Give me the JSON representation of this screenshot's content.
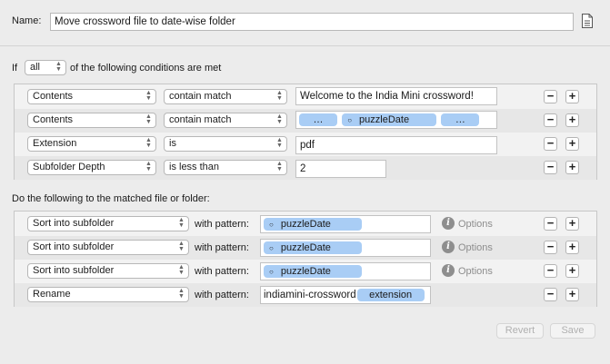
{
  "name_label": "Name:",
  "name_value": "Move crossword file to date-wise folder",
  "if_label": "If",
  "match_mode": "all",
  "conditions_suffix": "of the following conditions are met",
  "conditions": [
    {
      "attribute": "Contents",
      "operator": "contain match",
      "value_text": "Welcome to the India Mini crossword!"
    },
    {
      "attribute": "Contents",
      "operator": "contain match",
      "tokens": [
        "…",
        "puzzleDate",
        "…"
      ]
    },
    {
      "attribute": "Extension",
      "operator": "is",
      "value_text": "pdf"
    },
    {
      "attribute": "Subfolder Depth",
      "operator": "is less than",
      "value_text": "2"
    }
  ],
  "actions_label": "Do the following to the matched file or folder:",
  "actions": [
    {
      "action": "Sort into subfolder",
      "pattern_label": "with pattern:",
      "token": "puzzleDate",
      "options": "Options"
    },
    {
      "action": "Sort into subfolder",
      "pattern_label": "with pattern:",
      "token": "puzzleDate",
      "options": "Options"
    },
    {
      "action": "Sort into subfolder",
      "pattern_label": "with pattern:",
      "token": "puzzleDate",
      "options": "Options"
    },
    {
      "action": "Rename",
      "pattern_label": "with pattern:",
      "prefix": "indiamini-crossword",
      "token": "extension"
    }
  ],
  "minus": "−",
  "plus": "+",
  "info_glyph": "i",
  "revert_label": "Revert",
  "save_label": "Save",
  "colors": {
    "token": "#a9cdf5",
    "background": "#ececec"
  }
}
